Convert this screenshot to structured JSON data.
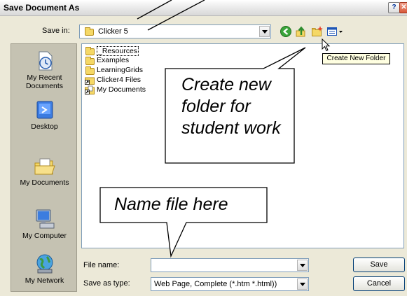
{
  "window": {
    "title": "Save Document As",
    "help_glyph": "?",
    "close_glyph": "✕"
  },
  "save_in": {
    "label": "Save in:",
    "value": "Clicker 5"
  },
  "toolbar": {
    "back_icon": "back-arrow-icon",
    "up_icon": "up-folder-icon",
    "new_folder_icon": "create-new-folder-icon",
    "views_icon": "views-menu-icon"
  },
  "tooltip": "Create New Folder",
  "places": [
    {
      "label_line1": "My Recent",
      "label_line2": "Documents",
      "icon": "recent-documents-icon"
    },
    {
      "label_line1": "Desktop",
      "label_line2": "",
      "icon": "desktop-icon"
    },
    {
      "label_line1": "My Documents",
      "label_line2": "",
      "icon": "my-documents-icon"
    },
    {
      "label_line1": "My Computer",
      "label_line2": "",
      "icon": "my-computer-icon"
    },
    {
      "label_line1": "My Network",
      "label_line2": "",
      "icon": "my-network-icon"
    }
  ],
  "files": [
    {
      "name": "_Resources",
      "type": "folder"
    },
    {
      "name": "Examples",
      "type": "folder"
    },
    {
      "name": "LearningGrids",
      "type": "folder"
    },
    {
      "name": "Clicker4 Files",
      "type": "shortcut-folder"
    },
    {
      "name": "My Documents",
      "type": "shortcut-folder"
    }
  ],
  "file_name": {
    "label": "File name:",
    "value": ""
  },
  "save_as_type": {
    "label": "Save as type:",
    "value": "Web Page, Complete (*.htm *.html))"
  },
  "buttons": {
    "save": "Save",
    "cancel": "Cancel"
  },
  "callouts": {
    "new_folder_line1": "Create new",
    "new_folder_line2": "folder for",
    "new_folder_line3": "student work",
    "name_file": "Name file here"
  }
}
